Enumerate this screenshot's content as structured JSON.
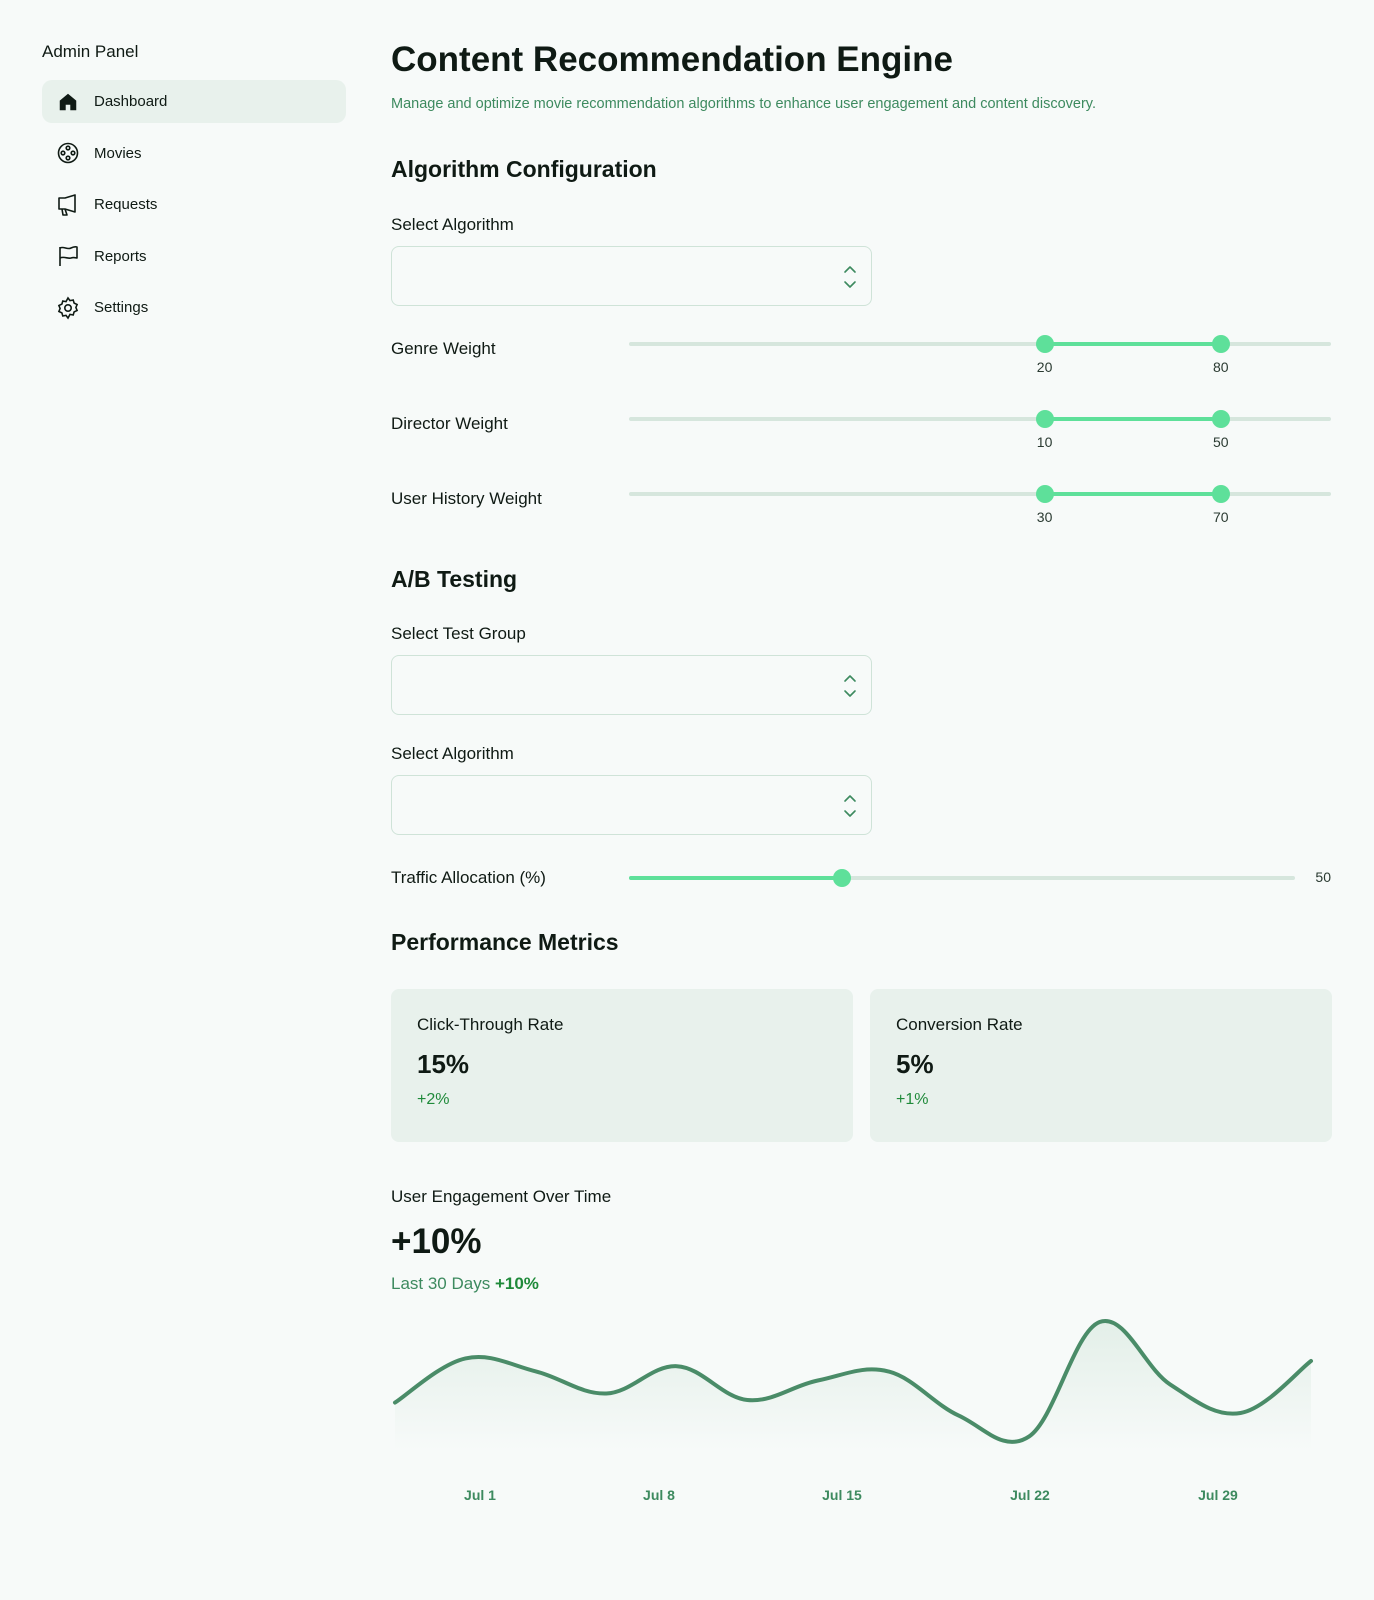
{
  "sidebar": {
    "title": "Admin Panel",
    "items": [
      {
        "label": "Dashboard",
        "icon": "home-icon",
        "active": true
      },
      {
        "label": "Movies",
        "icon": "film-reel-icon"
      },
      {
        "label": "Requests",
        "icon": "megaphone-icon"
      },
      {
        "label": "Reports",
        "icon": "flag-icon"
      },
      {
        "label": "Settings",
        "icon": "gear-icon"
      }
    ]
  },
  "header": {
    "title": "Content Recommendation Engine",
    "subtitle": "Manage and optimize movie recommendation algorithms to enhance user engagement and content discovery."
  },
  "algorithm_config": {
    "title": "Algorithm Configuration",
    "select_label": "Select Algorithm",
    "select_value": "",
    "sliders": [
      {
        "label": "Genre Weight",
        "min": 20,
        "max": 80
      },
      {
        "label": "Director Weight",
        "min": 10,
        "max": 50
      },
      {
        "label": "User History Weight",
        "min": 30,
        "max": 70
      }
    ]
  },
  "ab_testing": {
    "title": "A/B Testing",
    "test_group_label": "Select Test Group",
    "test_group_value": "",
    "algorithm_label": "Select Algorithm",
    "algorithm_value": "",
    "traffic_label": "Traffic Allocation (%)",
    "traffic_value": 50
  },
  "metrics": {
    "title": "Performance Metrics",
    "cards": [
      {
        "label": "Click-Through Rate",
        "value": "15%",
        "delta": "+2%"
      },
      {
        "label": "Conversion Rate",
        "value": "5%",
        "delta": "+1%"
      }
    ]
  },
  "engagement": {
    "label": "User Engagement Over Time",
    "value": "+10%",
    "period": "Last 30 Days",
    "period_change": "+10%"
  },
  "chart_data": {
    "type": "area",
    "categories": [
      "Jul 1",
      "Jul 8",
      "Jul 15",
      "Jul 22",
      "Jul 29"
    ],
    "series": [
      {
        "values": [
          38,
          72,
          62,
          45,
          66,
          40,
          55,
          62,
          28,
          12,
          100,
          52,
          30,
          70
        ]
      }
    ],
    "colors": {
      "line": "#4a8c68",
      "fill": "#e3efe8"
    }
  },
  "colors": {
    "accent": "#5ee09a",
    "positive": "#1f8a3a",
    "subtle_green": "#3d8a5f",
    "card_bg": "#e8f1ec"
  }
}
